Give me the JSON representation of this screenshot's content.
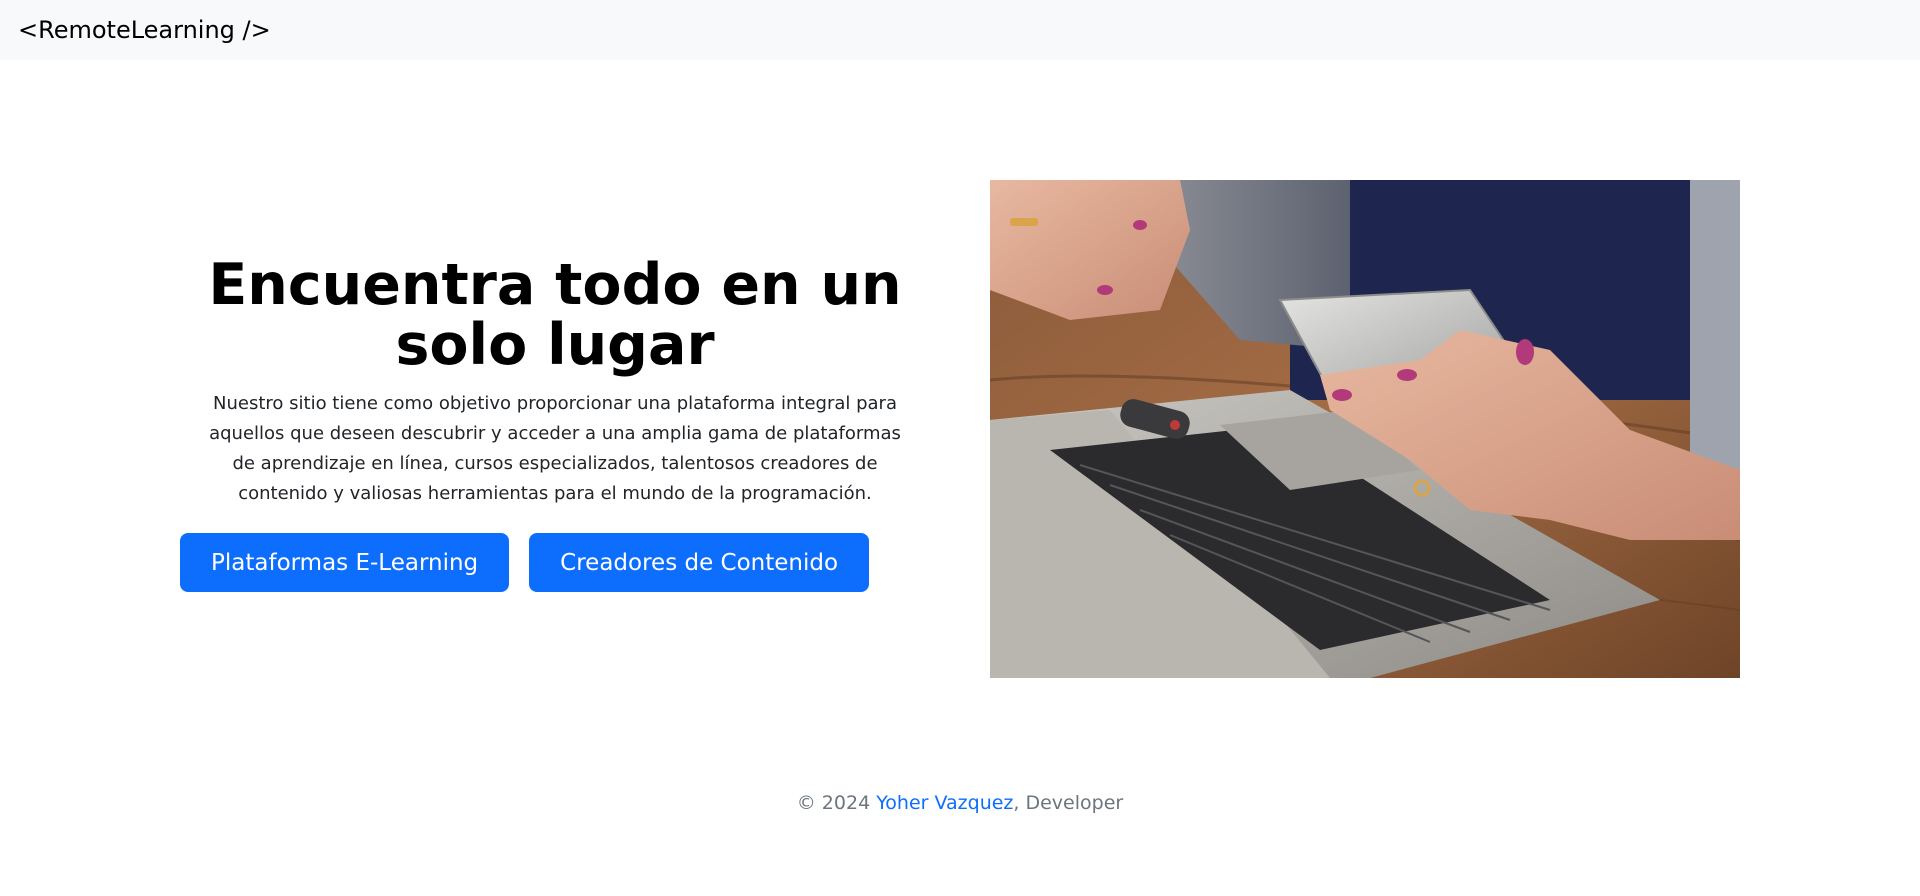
{
  "navbar": {
    "brand": "<RemoteLearning />"
  },
  "hero": {
    "title": "Encuentra todo en un solo lugar",
    "description": "Nuestro sitio tiene como objetivo proporcionar una plataforma integral para aquellos que deseen descubrir y acceder a una amplia gama de plataformas de aprendizaje en línea, cursos especializados, talentosos creadores de contenido y valiosas herramientas para el mundo de la programación.",
    "buttons": [
      {
        "label": "Plataformas E-Learning"
      },
      {
        "label": "Creadores de Contenido"
      }
    ],
    "image": {
      "subject": "hands-holding-phone-over-laptop"
    }
  },
  "footer": {
    "prefix": "© 2024 ",
    "author": "Yoher Vazquez",
    "suffix": ", Developer"
  },
  "colors": {
    "navbar_bg": "#f8f9fa",
    "button_primary": "#0d6efd",
    "link": "#0d6efd",
    "footer_text": "#6c757d"
  }
}
